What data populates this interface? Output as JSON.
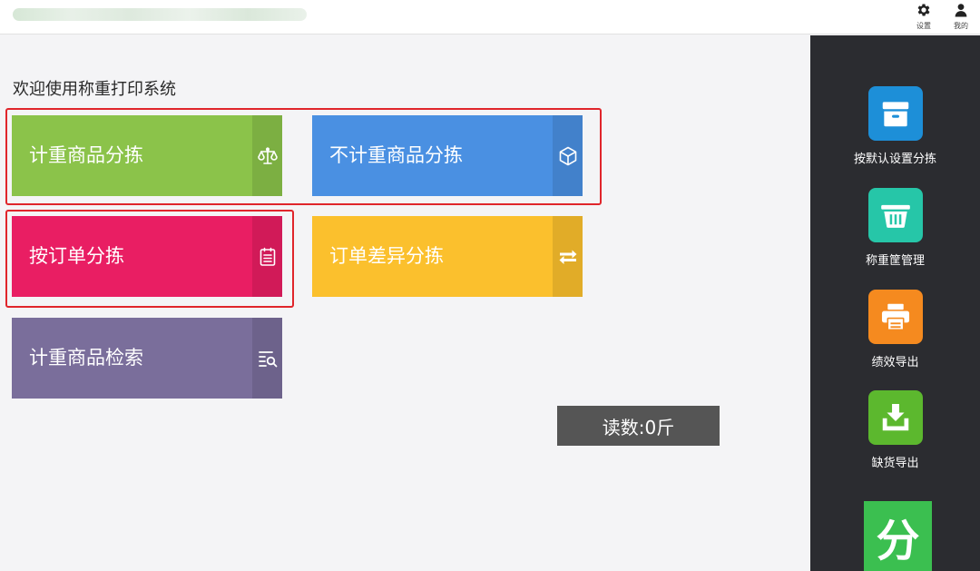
{
  "header": {
    "settings_label": "设置",
    "mine_label": "我的"
  },
  "main": {
    "welcome": "欢迎使用称重打印系统",
    "tiles": [
      {
        "label": "计重商品分拣",
        "icon": "scale-icon",
        "color": "#8bc34a"
      },
      {
        "label": "不计重商品分拣",
        "icon": "box-icon",
        "color": "#4a90e2"
      },
      {
        "label": "按订单分拣",
        "icon": "clipboard-icon",
        "color": "#e91e63"
      },
      {
        "label": "订单差异分拣",
        "icon": "swap-arrows-icon",
        "color": "#fbc02d"
      },
      {
        "label": "计重商品检索",
        "icon": "list-search-icon",
        "color": "#7a6e9b"
      }
    ],
    "reading": "读数:0斤"
  },
  "sidebar": {
    "items": [
      {
        "label": "按默认设置分拣",
        "icon": "storage-box-icon",
        "color": "#1d8fd8"
      },
      {
        "label": "称重筐管理",
        "icon": "basket-icon",
        "color": "#26c6a8"
      },
      {
        "label": "绩效导出",
        "icon": "printer-icon",
        "color": "#f58a1f"
      },
      {
        "label": "缺货导出",
        "icon": "download-tray-icon",
        "color": "#5cb82e"
      }
    ],
    "logo_text": "分",
    "logo_color": "#3bbf50"
  }
}
